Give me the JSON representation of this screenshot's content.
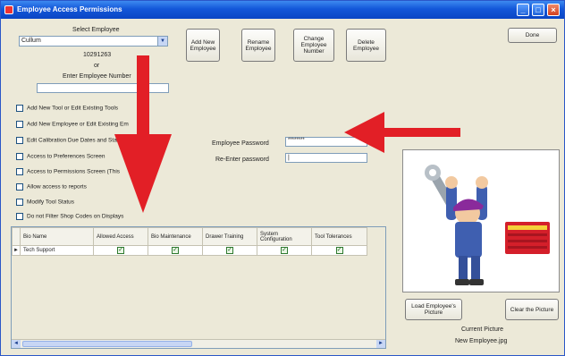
{
  "window": {
    "title": "Employee Access Permissions",
    "minimize_glyph": "_",
    "maximize_glyph": "□",
    "close_glyph": "×"
  },
  "employee": {
    "select_label": "Select Employee",
    "selected": "Cullum",
    "id_number": "10291263",
    "or_text": "or",
    "enter_number_label": "Enter Employee Number",
    "enter_number_value": ""
  },
  "toolbar": {
    "add_new": "Add New Employee",
    "rename": "Rename Employee",
    "change_number": "Change Employee Number",
    "delete": "Delete Employee",
    "done": "Done"
  },
  "permissions": [
    {
      "label": "Add New Tool or Edit Existing Tools",
      "checked": false
    },
    {
      "label": "Add New Employee or Edit Existing Em",
      "checked": false
    },
    {
      "label": "Edit Calibration Due Dates and Sta",
      "checked": false
    },
    {
      "label": "Access to Preferences Screen",
      "checked": false
    },
    {
      "label": "Access to Permissions Screen (This",
      "checked": false
    },
    {
      "label": "Allow access to reports",
      "checked": false
    },
    {
      "label": "Modify Tool Status",
      "checked": false
    },
    {
      "label": "Do not Filter Shop Codes on Displays",
      "checked": false
    }
  ],
  "password": {
    "label": "Employee Password",
    "value": "********",
    "reenter_label": "Re-Enter password",
    "reenter_value": "|"
  },
  "grid": {
    "columns": [
      "Bio Name",
      "Allowed Access",
      "Bio Maintenance",
      "Drawer Training",
      "System Configuration",
      "Tool Tolerances"
    ],
    "rows": [
      {
        "name": "Tech Support",
        "values": [
          true,
          true,
          true,
          true,
          true
        ]
      }
    ],
    "scroll_left": "◄",
    "scroll_right": "►",
    "row_indicator": "►"
  },
  "picture": {
    "load_button": "Load Employee's Picture",
    "clear_button": "Clear the Picture",
    "current_label": "Current Picture",
    "current_file": "New Employee.jpg"
  },
  "colors": {
    "title_bar": "#1357d9",
    "arrow": "#e21f26",
    "panel": "#ece9d8"
  }
}
